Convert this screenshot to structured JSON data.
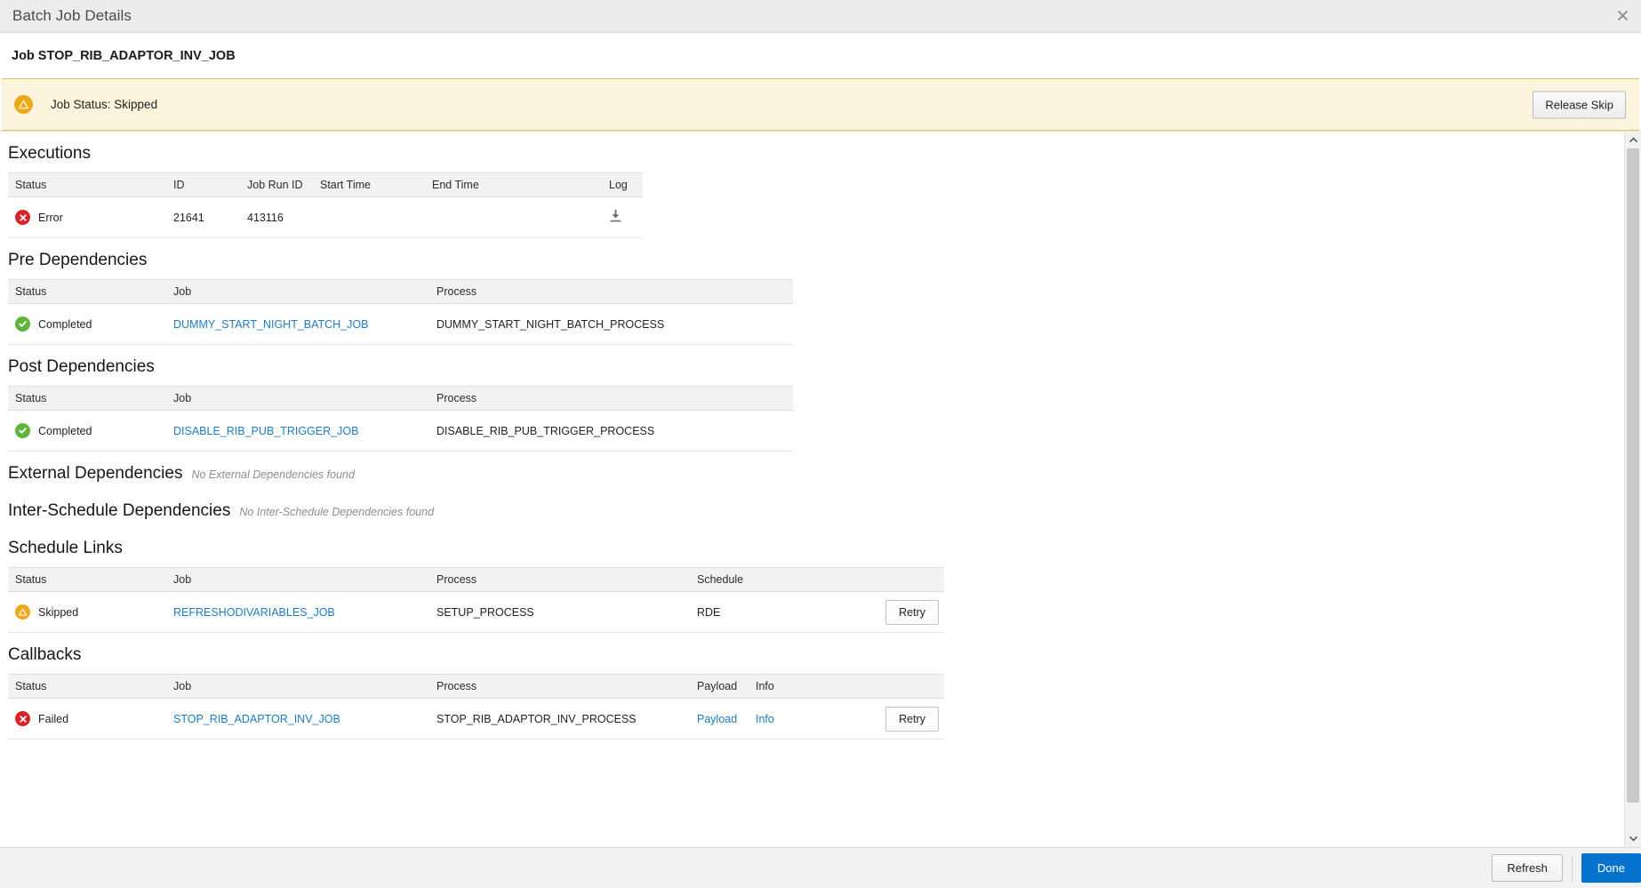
{
  "window": {
    "title": "Batch Job Details",
    "close_icon": "close-icon"
  },
  "job_header": {
    "text": "Job STOP_RIB_ADAPTOR_INV_JOB"
  },
  "banner": {
    "icon": "warning-icon",
    "status_text": "Job Status: Skipped",
    "action_label": "Release Skip",
    "bg_color": "#fcf4dd",
    "border_color": "#e8c55a",
    "icon_color": "#eea919"
  },
  "executions": {
    "title": "Executions",
    "columns": [
      "Status",
      "ID",
      "Job Run ID",
      "Start Time",
      "End Time",
      "Log"
    ],
    "rows": [
      {
        "status": "Error",
        "status_icon": "error-icon",
        "id": "21641",
        "job_run_id": "413116",
        "start_time": "",
        "end_time": "",
        "log_icon": "download-icon"
      }
    ]
  },
  "pre_dependencies": {
    "title": "Pre Dependencies",
    "columns": [
      "Status",
      "Job",
      "Process"
    ],
    "rows": [
      {
        "status": "Completed",
        "status_icon": "success-icon",
        "job": "DUMMY_START_NIGHT_BATCH_JOB",
        "process": "DUMMY_START_NIGHT_BATCH_PROCESS"
      }
    ]
  },
  "post_dependencies": {
    "title": "Post Dependencies",
    "columns": [
      "Status",
      "Job",
      "Process"
    ],
    "rows": [
      {
        "status": "Completed",
        "status_icon": "success-icon",
        "job": "DISABLE_RIB_PUB_TRIGGER_JOB",
        "process": "DISABLE_RIB_PUB_TRIGGER_PROCESS"
      }
    ]
  },
  "external_dependencies": {
    "title": "External Dependencies",
    "empty_text": "No External Dependencies found"
  },
  "inter_schedule_dependencies": {
    "title": "Inter-Schedule Dependencies",
    "empty_text": "No Inter-Schedule Dependencies found"
  },
  "schedule_links": {
    "title": "Schedule Links",
    "columns": [
      "Status",
      "Job",
      "Process",
      "Schedule",
      ""
    ],
    "rows": [
      {
        "status": "Skipped",
        "status_icon": "warning-icon",
        "job": "REFRESHODIVARIABLES_JOB",
        "process": "SETUP_PROCESS",
        "schedule": "RDE",
        "action_label": "Retry"
      }
    ]
  },
  "callbacks": {
    "title": "Callbacks",
    "columns": [
      "Status",
      "Job",
      "Process",
      "Payload",
      "Info",
      ""
    ],
    "rows": [
      {
        "status": "Failed",
        "status_icon": "error-icon",
        "job": "STOP_RIB_ADAPTOR_INV_JOB",
        "process": "STOP_RIB_ADAPTOR_INV_PROCESS",
        "payload_label": "Payload",
        "info_label": "Info",
        "action_label": "Retry"
      }
    ]
  },
  "footer": {
    "refresh_label": "Refresh",
    "done_label": "Done",
    "done_color": "#0572ce"
  },
  "scrollbar": {
    "up_icon": "chevron-up-icon",
    "down_icon": "chevron-down-icon"
  }
}
